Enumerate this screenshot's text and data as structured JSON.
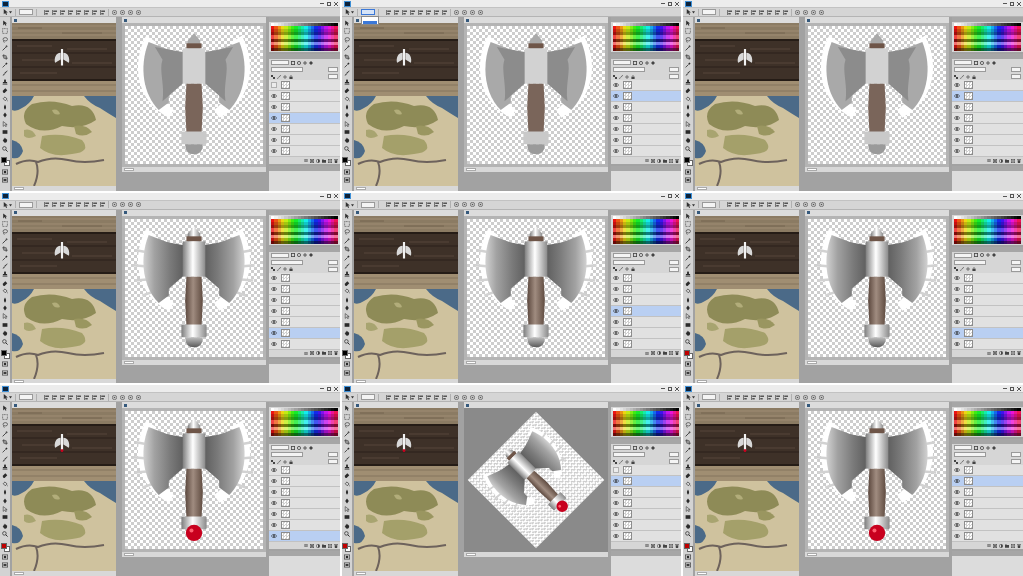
{
  "frames": [
    {
      "kind": "flat",
      "menu_open": false,
      "pommel_gem": false,
      "foreground_swatch": {
        "color": "#000000"
      },
      "layers": [
        {
          "visible": false,
          "selected": false
        },
        {
          "visible": true,
          "selected": false
        },
        {
          "visible": true,
          "selected": false
        },
        {
          "visible": true,
          "selected": true
        },
        {
          "visible": true,
          "selected": false
        },
        {
          "visible": true,
          "selected": false
        },
        {
          "visible": true,
          "selected": false
        }
      ]
    },
    {
      "kind": "flat",
      "menu_open": true,
      "pommel_gem": false,
      "foreground_swatch": {
        "color": "#000000"
      },
      "layers": [
        {
          "visible": true,
          "selected": false
        },
        {
          "visible": true,
          "selected": true
        },
        {
          "visible": true,
          "selected": false
        },
        {
          "visible": true,
          "selected": false
        },
        {
          "visible": true,
          "selected": false
        },
        {
          "visible": true,
          "selected": false
        },
        {
          "visible": true,
          "selected": false
        }
      ]
    },
    {
      "kind": "flat",
      "menu_open": false,
      "pommel_gem": false,
      "foreground_swatch": {
        "color": "#000000"
      },
      "layers": [
        {
          "visible": true,
          "selected": false
        },
        {
          "visible": true,
          "selected": true
        },
        {
          "visible": true,
          "selected": false
        },
        {
          "visible": true,
          "selected": false
        },
        {
          "visible": true,
          "selected": false
        },
        {
          "visible": true,
          "selected": false
        },
        {
          "visible": true,
          "selected": false
        }
      ]
    },
    {
      "kind": "shaded",
      "menu_open": false,
      "pommel_gem": false,
      "foreground_swatch": {
        "color": "#000000"
      },
      "layers": [
        {
          "visible": true,
          "selected": false
        },
        {
          "visible": true,
          "selected": false
        },
        {
          "visible": true,
          "selected": false
        },
        {
          "visible": true,
          "selected": false
        },
        {
          "visible": true,
          "selected": false
        },
        {
          "visible": true,
          "selected": true
        },
        {
          "visible": true,
          "selected": false
        }
      ]
    },
    {
      "kind": "shaded",
      "menu_open": false,
      "pommel_gem": false,
      "foreground_swatch": {
        "color": "#000000"
      },
      "layers": [
        {
          "visible": true,
          "selected": false
        },
        {
          "visible": true,
          "selected": false
        },
        {
          "visible": true,
          "selected": false
        },
        {
          "visible": true,
          "selected": true
        },
        {
          "visible": true,
          "selected": false
        },
        {
          "visible": true,
          "selected": false
        },
        {
          "visible": true,
          "selected": false
        }
      ]
    },
    {
      "kind": "shaded",
      "menu_open": false,
      "pommel_gem": false,
      "foreground_swatch": {
        "color": "#c00000"
      },
      "layers": [
        {
          "visible": true,
          "selected": false
        },
        {
          "visible": true,
          "selected": false
        },
        {
          "visible": true,
          "selected": false
        },
        {
          "visible": true,
          "selected": false
        },
        {
          "visible": true,
          "selected": false
        },
        {
          "visible": true,
          "selected": true
        },
        {
          "visible": true,
          "selected": false
        }
      ]
    },
    {
      "kind": "shaded",
      "menu_open": false,
      "pommel_gem": true,
      "foreground_swatch": {
        "color": "#c00000"
      },
      "layers": [
        {
          "visible": true,
          "selected": false
        },
        {
          "visible": true,
          "selected": false
        },
        {
          "visible": true,
          "selected": false
        },
        {
          "visible": true,
          "selected": false
        },
        {
          "visible": true,
          "selected": false
        },
        {
          "visible": true,
          "selected": false
        },
        {
          "visible": true,
          "selected": true
        }
      ]
    },
    {
      "kind": "rotated",
      "menu_open": false,
      "pommel_gem": true,
      "foreground_swatch": {
        "color": "#c00000"
      },
      "layers": [
        {
          "visible": false,
          "selected": false
        },
        {
          "visible": true,
          "selected": true
        },
        {
          "visible": true,
          "selected": false
        },
        {
          "visible": true,
          "selected": false
        },
        {
          "visible": true,
          "selected": false
        },
        {
          "visible": true,
          "selected": false
        },
        {
          "visible": true,
          "selected": false
        }
      ]
    },
    {
      "kind": "shaded",
      "menu_open": false,
      "pommel_gem": true,
      "foreground_swatch": {
        "color": "#c00000"
      },
      "layers": [
        {
          "visible": true,
          "selected": false
        },
        {
          "visible": true,
          "selected": true
        },
        {
          "visible": true,
          "selected": false
        },
        {
          "visible": true,
          "selected": false
        },
        {
          "visible": true,
          "selected": false
        },
        {
          "visible": true,
          "selected": false
        },
        {
          "visible": true,
          "selected": false
        }
      ]
    }
  ]
}
